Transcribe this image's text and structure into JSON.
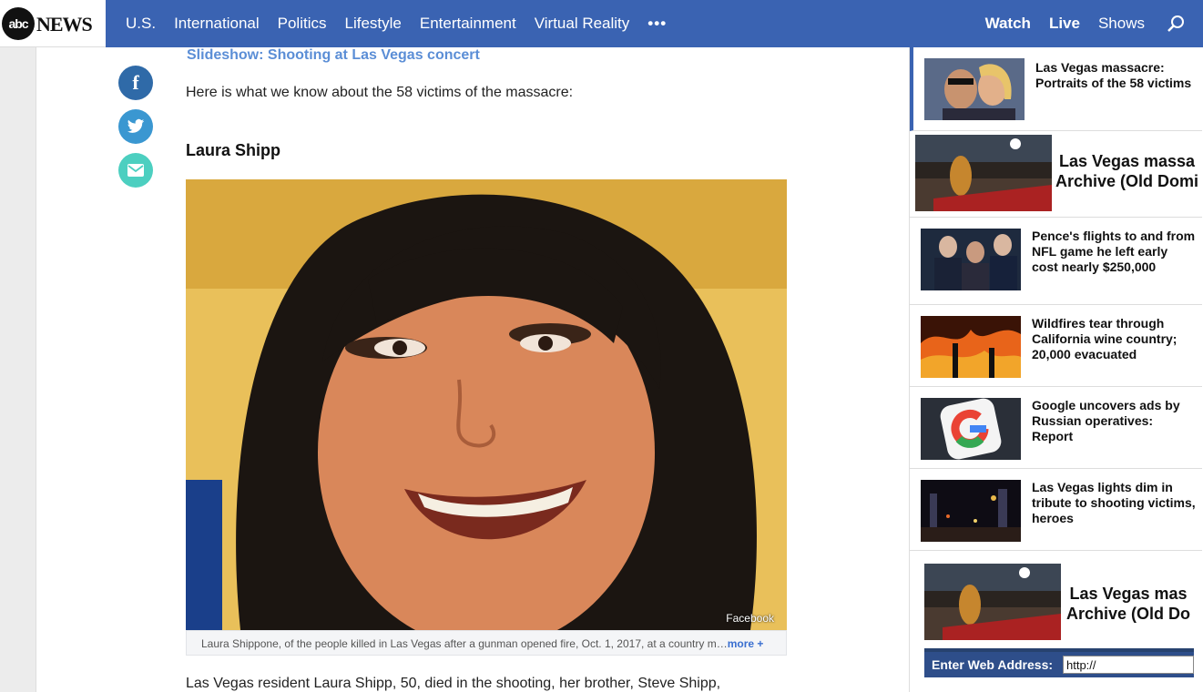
{
  "header": {
    "logo_abc": "abc",
    "logo_news": "NEWS",
    "nav": [
      "U.S.",
      "International",
      "Politics",
      "Lifestyle",
      "Entertainment",
      "Virtual Reality"
    ],
    "more": "•••",
    "watch": "Watch",
    "live": "Live",
    "shows": "Shows"
  },
  "share": {
    "facebook": "f"
  },
  "article": {
    "slideshow_link": "Slideshow: Shooting at Las Vegas concert",
    "intro": "Here is what we know about the 58 victims of the massacre:",
    "victim_name": "Laura Shipp",
    "photo_credit": "Facebook",
    "caption": "Laura Shippone, of the people killed in Las Vegas after a gunman opened fire, Oct. 1, 2017, at a country m…",
    "caption_more": "more +",
    "body": "Las Vegas resident Laura Shipp, 50, died in the shooting, her brother, Steve Shipp,"
  },
  "sidebar": {
    "items": [
      {
        "title": "Las Vegas massacre: Portraits of the 58 victims"
      },
      {
        "title": "Las Vegas massa… Archive (Old Domi…"
      },
      {
        "title": "Pence's flights to and from NFL game he left early cost nearly $250,000"
      },
      {
        "title": "Wildfires tear through California wine country; 20,000 evacuated"
      },
      {
        "title": "Google uncovers ads by Russian operatives: Report"
      },
      {
        "title": "Las Vegas lights dim in tribute to shooting victims, heroes"
      }
    ],
    "ad_line1": "Las Vegas massa",
    "ad_line2": "Archive (Old Domi",
    "ad2_line1": "Las Vegas mas",
    "ad2_line2": "Archive (Old Do",
    "web_label": "Enter Web Address:",
    "web_value": "http://"
  },
  "colors": {
    "header": "#3a63b2",
    "link": "#5b8ed6",
    "facebook": "#2f6aa8",
    "twitter": "#3a97d1",
    "email": "#4ccfc0"
  }
}
